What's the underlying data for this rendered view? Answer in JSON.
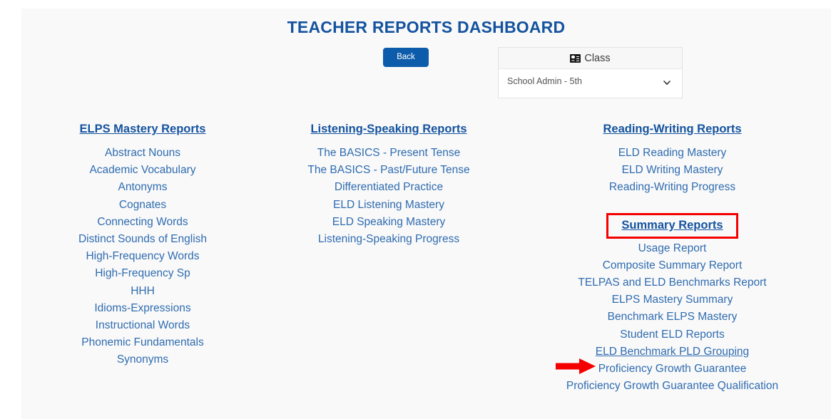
{
  "page": {
    "title": "TEACHER REPORTS DASHBOARD",
    "accent_blue": "#14539f",
    "link_blue": "#2f6cb0",
    "button_blue": "#0d5cab",
    "annotation_red": "#f50000",
    "background": "#f9f9f9"
  },
  "toolbar": {
    "back_label": "Back"
  },
  "class_panel": {
    "header_label": "Class",
    "icon": "id-card-icon",
    "selected_value": "School Admin - 5th",
    "options": [
      "School Admin - 5th"
    ],
    "chevron": "chevron-down-icon"
  },
  "columns": [
    {
      "id": "elps-mastery",
      "heading": "ELPS Mastery Reports",
      "links": [
        "Abstract Nouns",
        "Academic Vocabulary",
        "Antonyms",
        "Cognates",
        "Connecting Words",
        "Distinct Sounds of English",
        "High-Frequency Words",
        "High-Frequency Sp",
        "HHH",
        "Idioms-Expressions",
        "Instructional Words",
        "Phonemic Fundamentals",
        "Synonyms"
      ]
    },
    {
      "id": "listening-speaking",
      "heading": "Listening-Speaking Reports",
      "links": [
        "The BASICS - Present Tense",
        "The BASICS - Past/Future Tense",
        "Differentiated Practice",
        "ELD Listening Mastery",
        "ELD Speaking Mastery",
        "Listening-Speaking Progress"
      ]
    },
    {
      "id": "reading-writing",
      "heading": "Reading-Writing Reports",
      "links": [
        "ELD Reading Mastery",
        "ELD Writing Mastery",
        "Reading-Writing Progress"
      ]
    }
  ],
  "summary_section": {
    "heading": "Summary Reports",
    "heading_highlighted": true,
    "links": [
      "Usage Report",
      "Composite Summary Report",
      "TELPAS and ELD Benchmarks Report",
      "ELPS Mastery Summary",
      "Benchmark ELPS Mastery",
      "Student ELD Reports",
      "ELD Benchmark PLD Grouping",
      "Proficiency Growth Guarantee",
      "Proficiency Growth Guarantee Qualification"
    ],
    "hovered_link": "ELD Benchmark PLD Grouping"
  },
  "annotations": {
    "arrow_target": "ELD Benchmark PLD Grouping",
    "arrow_color": "#f50000",
    "box_target": "Summary Reports",
    "box_color": "#f50000"
  }
}
